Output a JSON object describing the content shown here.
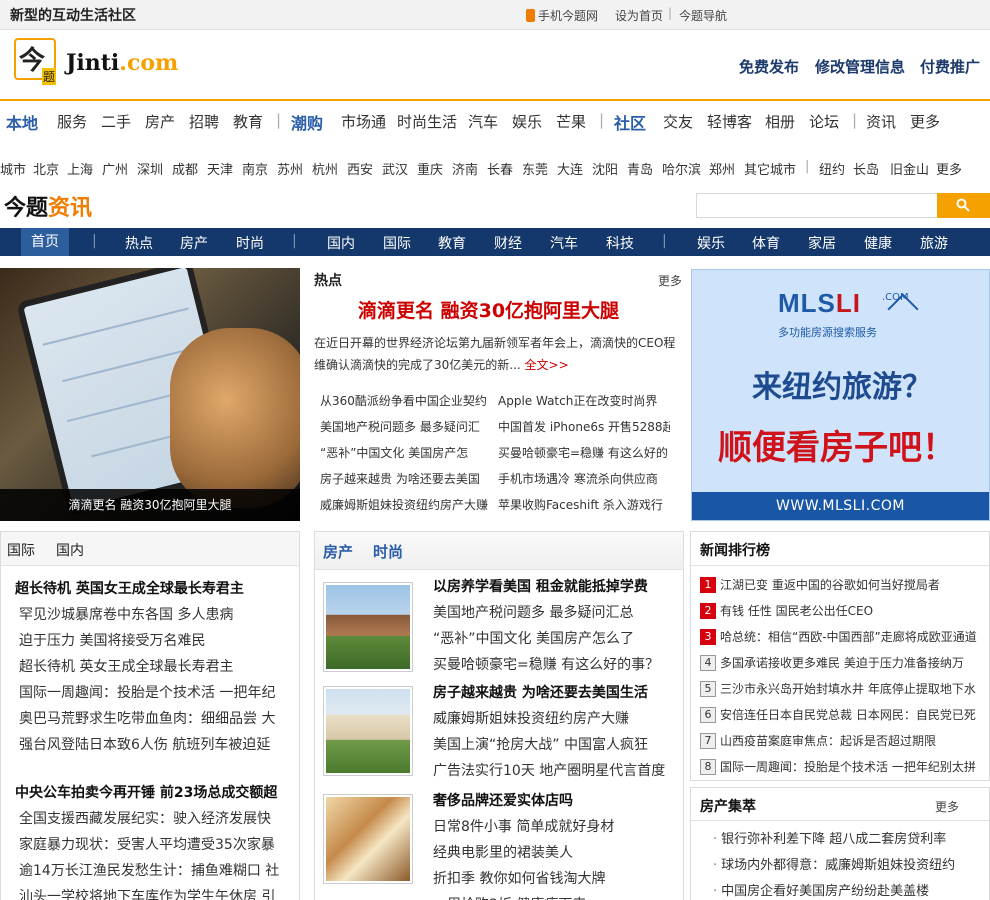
{
  "topbar": {
    "slogan": "新型的互动生活社区",
    "mobile": "手机今题网",
    "set_home": "设为首页",
    "separator": "|",
    "nav": "今题导航"
  },
  "header": {
    "logo_char_1": "今",
    "logo_char_2": "题",
    "logo_text": "Jinti",
    "logo_text_suffix": ".com",
    "links": [
      "免费发布",
      "修改管理信息",
      "付费推广"
    ]
  },
  "channels": [
    {
      "label": "本地",
      "hl": true
    },
    {
      "label": "服务"
    },
    {
      "label": "二手"
    },
    {
      "label": "房产"
    },
    {
      "label": "招聘"
    },
    {
      "label": "教育"
    },
    {
      "label": "|",
      "bar": true
    },
    {
      "label": "潮购",
      "hl": true
    },
    {
      "label": "市场通"
    },
    {
      "label": "时尚生活"
    },
    {
      "label": "汽车"
    },
    {
      "label": "娱乐"
    },
    {
      "label": "芒果"
    },
    {
      "label": "|",
      "bar": true
    },
    {
      "label": "社区",
      "hl": true
    },
    {
      "label": "交友"
    },
    {
      "label": "轻博客"
    },
    {
      "label": "相册"
    },
    {
      "label": "论坛"
    },
    {
      "label": "|",
      "bar": true
    },
    {
      "label": "资讯"
    },
    {
      "label": "更多"
    }
  ],
  "cities": [
    "城市",
    "北京",
    "上海",
    "广州",
    "深圳",
    "成都",
    "天津",
    "南京",
    "苏州",
    "杭州",
    "西安",
    "武汉",
    "重庆",
    "济南",
    "长春",
    "东莞",
    "大连",
    "沈阳",
    "青岛",
    "哈尔滨",
    "郑州",
    "其它城市",
    "|",
    "纽约",
    "长岛",
    "旧金山",
    "更多"
  ],
  "zixun": {
    "title_a": "今题",
    "title_b": "资讯",
    "search_placeholder": "",
    "search_icon": "search-icon"
  },
  "bluenav": [
    "首页",
    "|",
    "热点",
    "房产",
    "时尚",
    "|",
    "国内",
    "国际",
    "教育",
    "财经",
    "汽车",
    "科技",
    "|",
    "娱乐",
    "体育",
    "家居",
    "健康",
    "旅游"
  ],
  "hero": {
    "caption": "滴滴更名 融资30亿抱阿里大腿"
  },
  "hot": {
    "heading": "热点",
    "more": "更多",
    "headline": "滴滴更名  融资30亿抱阿里大腿",
    "summary": "在近日开幕的世界经济论坛第九届新领军者年会上，滴滴快的CEO程维确认滴滴快的完成了30亿美元的新...",
    "full_text": "全文>>",
    "items": [
      [
        "从360酷派纷争看中国企业契约",
        "Apple Watch正在改变时尚界"
      ],
      [
        "美国地产税问题多 最多疑问汇",
        "中国首发 iPhone6s 开售5288起"
      ],
      [
        "“恶补”中国文化 美国房产怎",
        "买曼哈顿豪宅=稳赚 有这么好的"
      ],
      [
        "房子越来越贵 为啥还要去美国",
        "手机市场遇冷 寒流杀向供应商"
      ],
      [
        "威廉姆斯姐妹投资纽约房产大赚",
        "苹果收购Faceshift 杀入游戏行"
      ]
    ]
  },
  "ad": {
    "logo_a": "MLS",
    "logo_b": "LI",
    "domain": ".COM",
    "sub": "多功能房源搜索服务",
    "line1": "来纽约旅游？",
    "line2": "顺便看房子吧！",
    "url": "WWW.MLSLI.COM"
  },
  "intl": {
    "tabs": [
      "国际",
      "国内"
    ],
    "title1": "超长待机 英国女王成全球最长寿君主",
    "list1": [
      "罕见沙城暴席卷中东各国 多人患病",
      "迫于压力 美国将接受万名难民",
      "超长待机 英女王成全球最长寿君主",
      "国际一周趣闻：投胎是个技术活 一把年纪",
      "奥巴马荒野求生吃带血鱼肉：细细品尝 大",
      "强台风登陆日本致6人伤 航班列车被迫延"
    ],
    "title2": "中央公车拍卖今再开锤 前23场总成交额超",
    "list2": [
      "全国支援西藏发展纪实：驶入经济发展快",
      "家庭暴力现状：受害人平均遭受35次家暴",
      "逾14万长江渔民发愁生计：捕鱼难糊口 社",
      "汕头一学校将地下车库作为学生午休房 引"
    ]
  },
  "fang": {
    "tabs": [
      "房产",
      "时尚"
    ],
    "groups": [
      {
        "title": "以房养学看美国 租金就能抵掉学费",
        "items": [
          "美国地产税问题多 最多疑问汇总",
          "“恶补”中国文化 美国房产怎么了",
          "买曼哈顿豪宅=稳赚 有这么好的事？"
        ]
      },
      {
        "title": "房子越来越贵 为啥还要去美国生活",
        "items": [
          "威廉姆斯姐妹投资纽约房产大赚",
          "美国上演“抢房大战” 中国富人疯狂",
          "广告法实行10天 地产圈明星代言首度"
        ]
      },
      {
        "title": "奢侈品牌还爱实体店吗",
        "items": [
          "日常8件小事 简单成就好身材",
          "经典电影里的裙装美人",
          "折扣季 教你如何省钱淘大牌",
          "一周抢购3折 健康瘦下来"
        ]
      }
    ]
  },
  "rank": {
    "heading": "新闻排行榜",
    "items": [
      {
        "n": "1",
        "text": "江湖已变 重返中国的谷歌如何当好搅局者"
      },
      {
        "n": "2",
        "text": "有钱 任性 国民老公出任CEO"
      },
      {
        "n": "3",
        "text": "哈总统：相信“西欧-中国西部”走廊将成欧亚通道"
      },
      {
        "n": "4",
        "text": "多国承诺接收更多难民 美迫于压力准备接纳万"
      },
      {
        "n": "5",
        "text": "三沙市永兴岛开始封填水井 年底停止提取地下水"
      },
      {
        "n": "6",
        "text": "安倍连任日本自民党总裁 日本网民：自民党已死"
      },
      {
        "n": "7",
        "text": "山西疫苗案庭审焦点：起诉是否超过期限"
      },
      {
        "n": "8",
        "text": "国际一周趣闻：投胎是个技术活 一把年纪别太拼"
      }
    ]
  },
  "jicui": {
    "heading": "房产集萃",
    "more": "更多",
    "bullet": "·",
    "items": [
      "银行弥补利差下降 超八成二套房贷利率",
      "球场内外都得意：威廉姆斯姐妹投资纽约",
      "中国房企看好美国房产纷纷赴美盖楼"
    ]
  }
}
